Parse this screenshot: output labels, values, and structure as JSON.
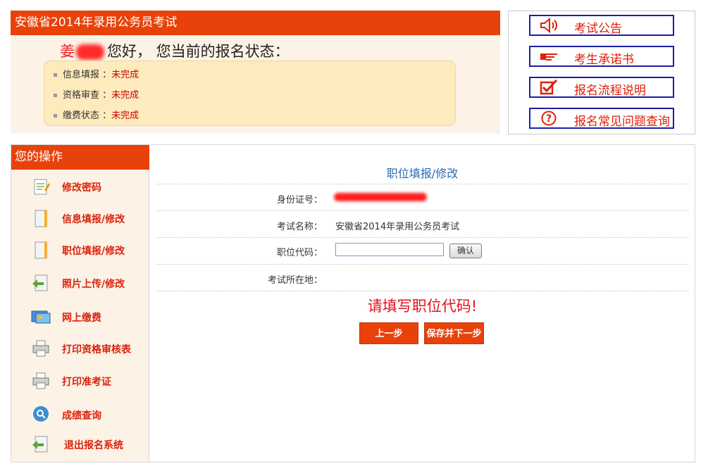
{
  "status_panel": {
    "header": "安徽省2014年录用公务员考试",
    "greeting_name": "姜",
    "greeting_text": "您好， 您当前的报名状态：",
    "items": [
      {
        "label": "信息填报",
        "sep": " ：",
        "value": "未完成"
      },
      {
        "label": "资格审查",
        "sep": " ：",
        "value": "未完成"
      },
      {
        "label": "缴费状态",
        "sep": " ：",
        "value": "未完成"
      }
    ]
  },
  "links": [
    {
      "label": "考试公告",
      "icon": "speaker-icon"
    },
    {
      "label": "考生承诺书",
      "icon": "pointing-hand-icon"
    },
    {
      "label": "报名流程说明",
      "icon": "checkbox-icon"
    },
    {
      "label": "报名常见问题查询",
      "icon": "question-icon"
    }
  ],
  "sidebar": {
    "header": "您的操作",
    "items": [
      {
        "label": "修改密码",
        "icon": "edit-note-icon"
      },
      {
        "label": "信息填报/修改",
        "icon": "document-icon"
      },
      {
        "label": "职位填报/修改",
        "icon": "document-icon"
      },
      {
        "label": "照片上传/修改",
        "icon": "upload-icon"
      },
      {
        "label": "网上缴费",
        "icon": "payment-card-icon"
      },
      {
        "label": "打印资格审核表",
        "icon": "printer-icon"
      },
      {
        "label": "打印准考证",
        "icon": "printer-icon"
      },
      {
        "label": "成绩查询",
        "icon": "search-icon"
      },
      {
        "label": "退出报名系统",
        "icon": "exit-icon"
      }
    ]
  },
  "main": {
    "title": "职位填报/修改",
    "id_label": "身份证号：",
    "exam_label": "考试名称：",
    "exam_value": "安徽省2014年录用公务员考试",
    "code_label": "职位代码：",
    "code_value": "",
    "confirm_label": "确认",
    "location_label": "考试所在地：",
    "error_message": "请填写职位代码!",
    "prev_button": "上一步",
    "save_button": "保存并下一步"
  },
  "colors": {
    "header_orange": "#e8420a",
    "link_border": "#1b1fa8",
    "title_blue": "#2a6ab3",
    "error_red": "#e4101a"
  }
}
